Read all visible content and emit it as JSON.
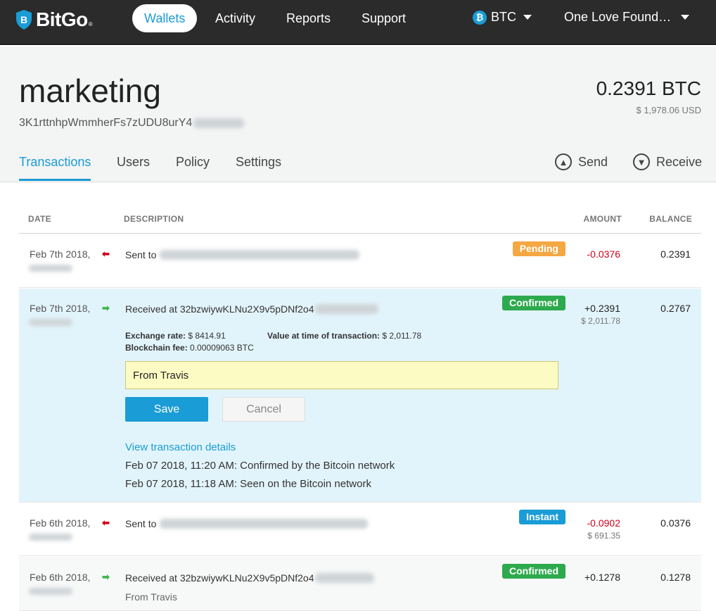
{
  "nav": {
    "logo_text": "BitGo",
    "logo_reg": "®",
    "items": [
      {
        "label": "Wallets"
      },
      {
        "label": "Activity"
      },
      {
        "label": "Reports"
      },
      {
        "label": "Support"
      }
    ],
    "coin": "BTC",
    "org": "One Love Found…"
  },
  "wallet": {
    "name": "marketing",
    "address": "3K1rttnhpWmmherFs7zUDU8urY4",
    "balance": "0.2391 BTC",
    "balance_usd": "$ 1,978.06 USD",
    "tabs": [
      {
        "label": "Transactions"
      },
      {
        "label": "Users"
      },
      {
        "label": "Policy"
      },
      {
        "label": "Settings"
      }
    ],
    "send_label": "Send",
    "receive_label": "Receive"
  },
  "table": {
    "headers": {
      "date": "DATE",
      "description": "DESCRIPTION",
      "amount": "AMOUNT",
      "balance": "BALANCE"
    },
    "rows": [
      {
        "date": "Feb 7th 2018,",
        "desc": "Sent to",
        "status": "Pending",
        "amount": "-0.0376",
        "balance": "0.2391"
      },
      {
        "date": "Feb 7th 2018,",
        "desc": "Received at 32bzwiywKLNu2X9v5pDNf2o4",
        "status": "Confirmed",
        "amount": "+0.2391",
        "amount_usd": "$ 2,011.78",
        "balance": "0.2767"
      },
      {
        "date": "Feb 6th 2018,",
        "desc": "Sent to",
        "status": "Instant",
        "amount": "-0.0902",
        "amount_usd": "$ 691.35",
        "balance": "0.0376"
      },
      {
        "date": "Feb 6th 2018,",
        "desc": "Received at 32bzwiywKLNu2X9v5pDNf2o4",
        "status": "Confirmed",
        "amount": "+0.1278",
        "balance": "0.1278",
        "memo": "From Travis"
      }
    ]
  },
  "expanded": {
    "exchange_rate_label": "Exchange rate:",
    "exchange_rate": "$ 8414.91",
    "value_label": "Value at time of transaction:",
    "value": "$ 2,011.78",
    "fee_label": "Blockchain fee:",
    "fee": "0.00009063 BTC",
    "memo_value": "From Travis",
    "save_label": "Save",
    "cancel_label": "Cancel",
    "view_details": "View transaction details",
    "events": [
      "Feb 07 2018, 11:20 AM: Confirmed by the Bitcoin network",
      "Feb 07 2018, 11:18 AM: Seen on the Bitcoin network"
    ]
  },
  "colors": {
    "accent": "#1a9cd6",
    "nav_bg": "#2b2b2b",
    "pending": "#f5a742",
    "confirmed": "#2eaa4e",
    "negative": "#d0021b",
    "expanded_bg": "#e2f4fb"
  }
}
